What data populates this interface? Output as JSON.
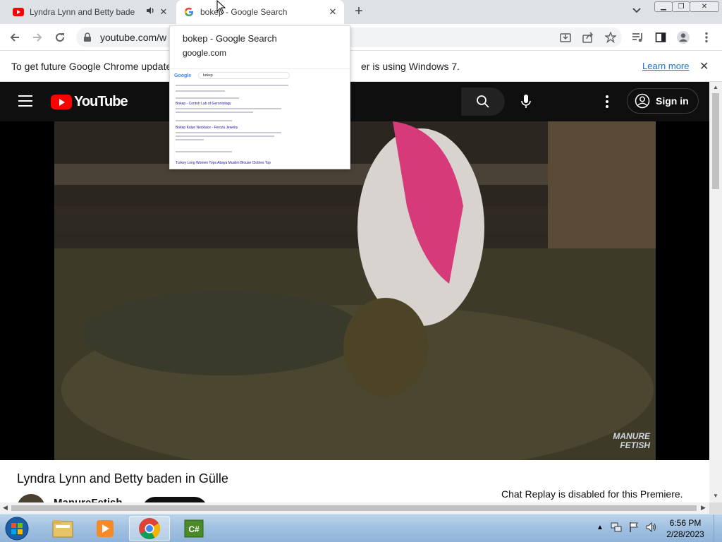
{
  "browser": {
    "tabs": [
      {
        "title": "Lyndra Lynn and Betty baden in Gülle",
        "active": false,
        "audio": true
      },
      {
        "title": "bokep - Google Search",
        "active": true
      }
    ],
    "omnibox_url": "youtube.com/w",
    "hover_card": {
      "title": "bokep - Google Search",
      "domain": "google.com"
    },
    "infobar": {
      "message": "To get future Google Chrome updates,",
      "message_tail": "er is using Windows 7.",
      "learn_more": "Learn more"
    }
  },
  "youtube": {
    "logo_text": "YouTube",
    "sign_in": "Sign in",
    "video_watermark_line1": "MANURE",
    "video_watermark_line2": "FETISH",
    "video_title": "Lyndra Lynn and Betty baden in Gülle",
    "channel_name": "ManureFetish",
    "chat_replay": "Chat Replay is disabled for this Premiere."
  },
  "preview": {
    "logo": "Google",
    "query": "bokep",
    "result_title_1": "Bokep - Contoh Lab of Gerontology",
    "result_title_2": "Bokep Kalye Necklace - Feroza Jewelry",
    "result_title_3": "Turkey Long Women Tops Abaya Muslim Blouse Clothes Top"
  },
  "taskbar": {
    "time": "6:56 PM",
    "date": "2/28/2023"
  },
  "colors": {
    "youtube_red": "#ff0000",
    "chrome_blue": "#1a73e8",
    "yt_dark": "#0f0f0f"
  }
}
